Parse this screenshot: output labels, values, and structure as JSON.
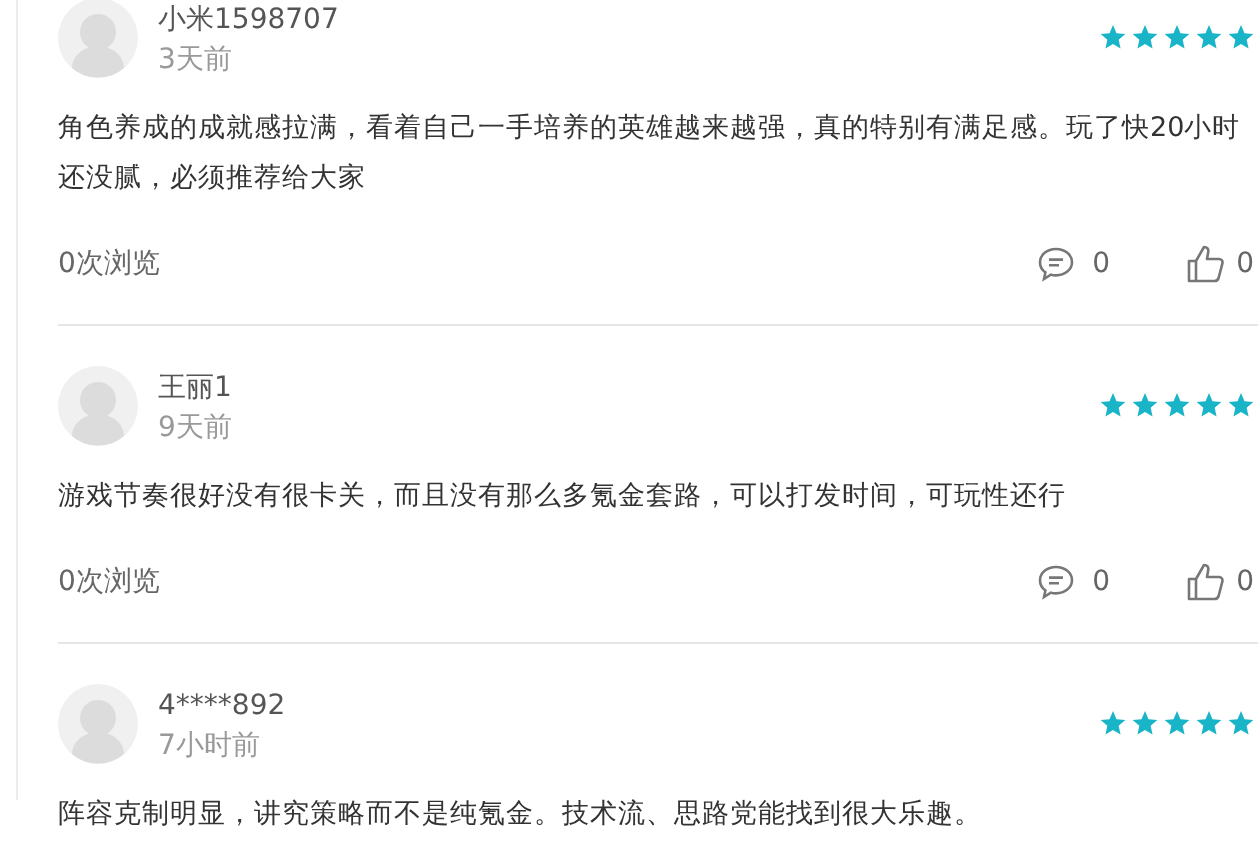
{
  "reviews": [
    {
      "user": "小米1598707",
      "time": "3天前",
      "stars": 5,
      "text": "角色养成的成就感拉满，看着自己一手培养的英雄越来越强，真的特别有满足感。玩了快20小时还没腻，必须推荐给大家",
      "views": "0次浏览",
      "comments": "0",
      "likes": "0"
    },
    {
      "user": "王丽1",
      "time": "9天前",
      "stars": 5,
      "text": "游戏节奏很好没有很卡关，而且没有那么多氪金套路，可以打发时间，可玩性还行",
      "views": "0次浏览",
      "comments": "0",
      "likes": "0"
    },
    {
      "user": "4****892",
      "time": "7小时前",
      "stars": 5,
      "text": "阵容克制明显，讲究策略而不是纯氪金。技术流、思路党能找到很大乐趣。"
    }
  ]
}
